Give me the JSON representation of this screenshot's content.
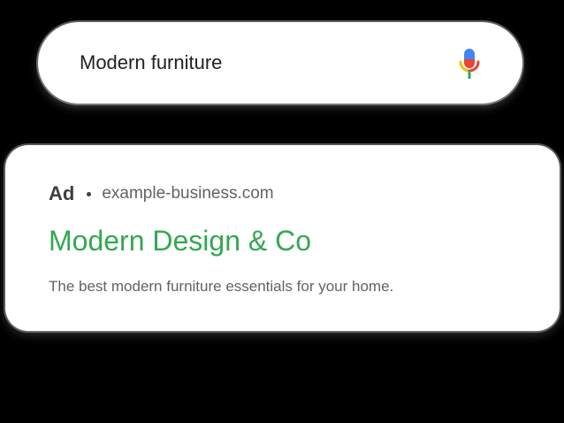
{
  "search": {
    "query": "Modern furniture",
    "mic_icon": "microphone-icon"
  },
  "ad": {
    "label": "Ad",
    "domain": "example-business.com",
    "title": "Modern Design & Co",
    "description": "The best modern furniture essentials for your home."
  },
  "colors": {
    "background": "#000000",
    "card": "#ffffff",
    "ad_title": "#34a853",
    "mic_blue": "#4285f4",
    "mic_red": "#ea4335",
    "mic_yellow": "#fbbc04",
    "mic_green": "#34a853"
  }
}
